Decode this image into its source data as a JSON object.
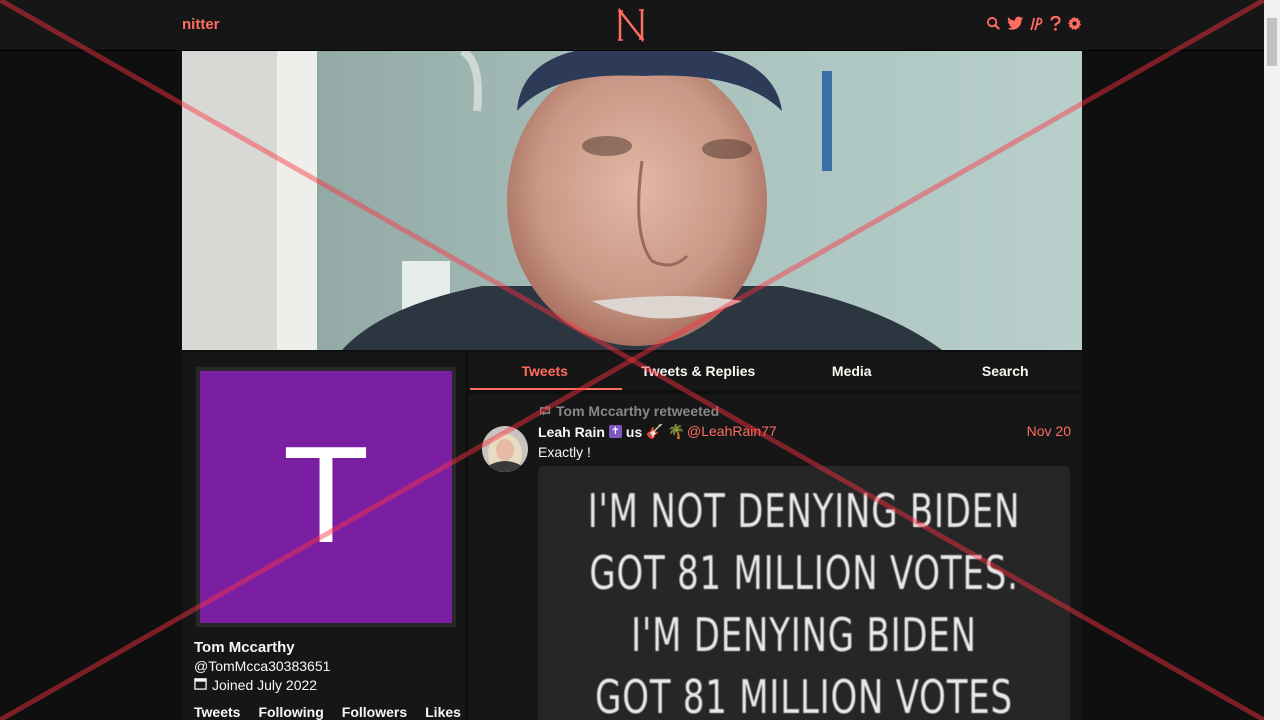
{
  "nav": {
    "brand": "nitter",
    "logo_letter": "N",
    "icons": [
      "search-icon",
      "twitter-icon",
      "rss-icon",
      "help-icon",
      "gear-icon"
    ],
    "accent_color": "#ff6c60"
  },
  "profile": {
    "avatar_letter": "T",
    "avatar_color": "#7b1fa2",
    "fullname": "Tom Mccarthy",
    "username": "@TomMcca30383651",
    "joined": "Joined July 2022",
    "stats": [
      "Tweets",
      "Following",
      "Followers",
      "Likes"
    ]
  },
  "tabs": [
    {
      "label": "Tweets",
      "active": true
    },
    {
      "label": "Tweets & Replies",
      "active": false
    },
    {
      "label": "Media",
      "active": false
    },
    {
      "label": "Search",
      "active": false
    }
  ],
  "tweet": {
    "retweet_header": "Tom Mccarthy retweeted",
    "fullname": "Leah Rain",
    "emoji_text": "us",
    "username": "@LeahRain77",
    "date": "Nov 20",
    "text": "Exactly !",
    "media_lines": [
      "I'M NOT DENYING BIDEN",
      "GOT 81 MILLION VOTES.",
      "I'M DENYING BIDEN",
      "GOT 81 MILLION VOTES"
    ]
  }
}
